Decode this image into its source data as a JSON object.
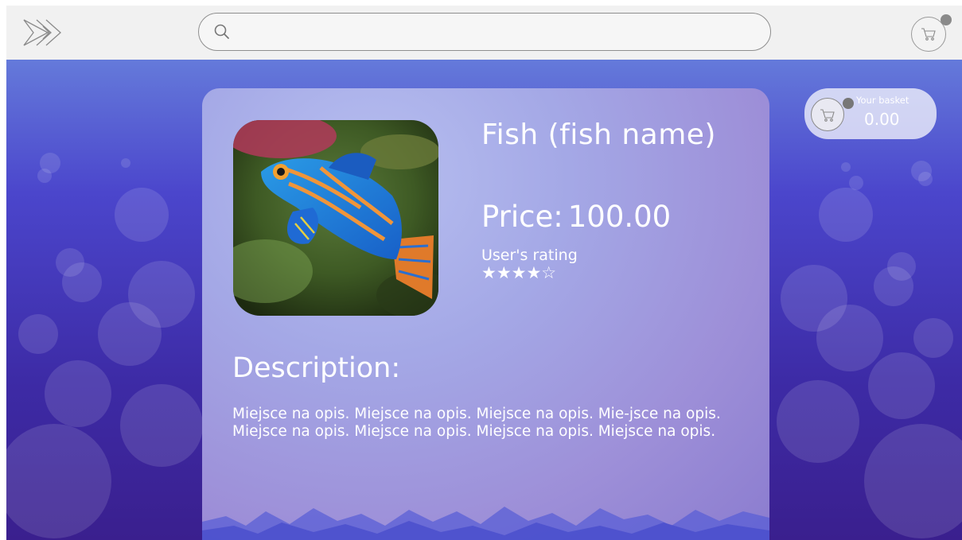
{
  "header": {
    "logo_icon": "fish-outline-logo-icon",
    "search": {
      "placeholder": "",
      "value": "",
      "icon": "search-icon"
    },
    "cart_icon": "shopping-cart-icon"
  },
  "basket": {
    "label": "Your basket",
    "total": "0.00",
    "icon": "shopping-cart-icon"
  },
  "product": {
    "name": "Fish (fish name)",
    "price_label": "Price:",
    "price_value": "100.00",
    "rating_label": "User's rating",
    "rating": 4,
    "rating_max": 5,
    "stars_text": "★★★★☆",
    "description_heading": "Description:",
    "description_text": "Miejsce na opis. Miejsce na opis. Miejsce na opis. Mie-jsce na opis. Miejsce na opis. Miejsce na opis. Miejsce na opis. Miejsce na opis."
  },
  "colors": {
    "topbar": "#f1f1f1",
    "background_top": "#6f8fe0",
    "background_bottom": "#3a1f8e",
    "card": "#a4a8e6",
    "text": "#ffffff"
  }
}
